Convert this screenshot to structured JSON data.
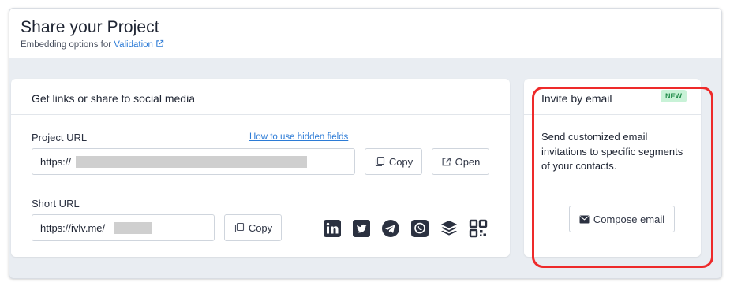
{
  "header": {
    "title": "Share your Project",
    "subtitle_prefix": "Embedding options for",
    "subtitle_link": "Validation"
  },
  "share_card": {
    "title": "Get links or share to social media",
    "project_url": {
      "label": "Project URL",
      "help_link": "How to use hidden fields",
      "value": "https://"
    },
    "short_url": {
      "label": "Short URL",
      "value": "https://ivlv.me/"
    },
    "copy_label": "Copy",
    "open_label": "Open",
    "social_icons": [
      "linkedin-icon",
      "twitter-icon",
      "telegram-icon",
      "whatsapp-icon",
      "buffer-icon",
      "qr-code-icon"
    ]
  },
  "email_card": {
    "title": "Invite by email",
    "badge": "NEW",
    "description": "Send customized email invitations to specific segments of your contacts.",
    "compose_label": "Compose email"
  },
  "colors": {
    "accent_link": "#2c7bd6",
    "badge_bg": "#c8f2d7",
    "badge_text": "#1f8a48",
    "highlight": "#ee2a2a",
    "icon": "#2b3140"
  }
}
